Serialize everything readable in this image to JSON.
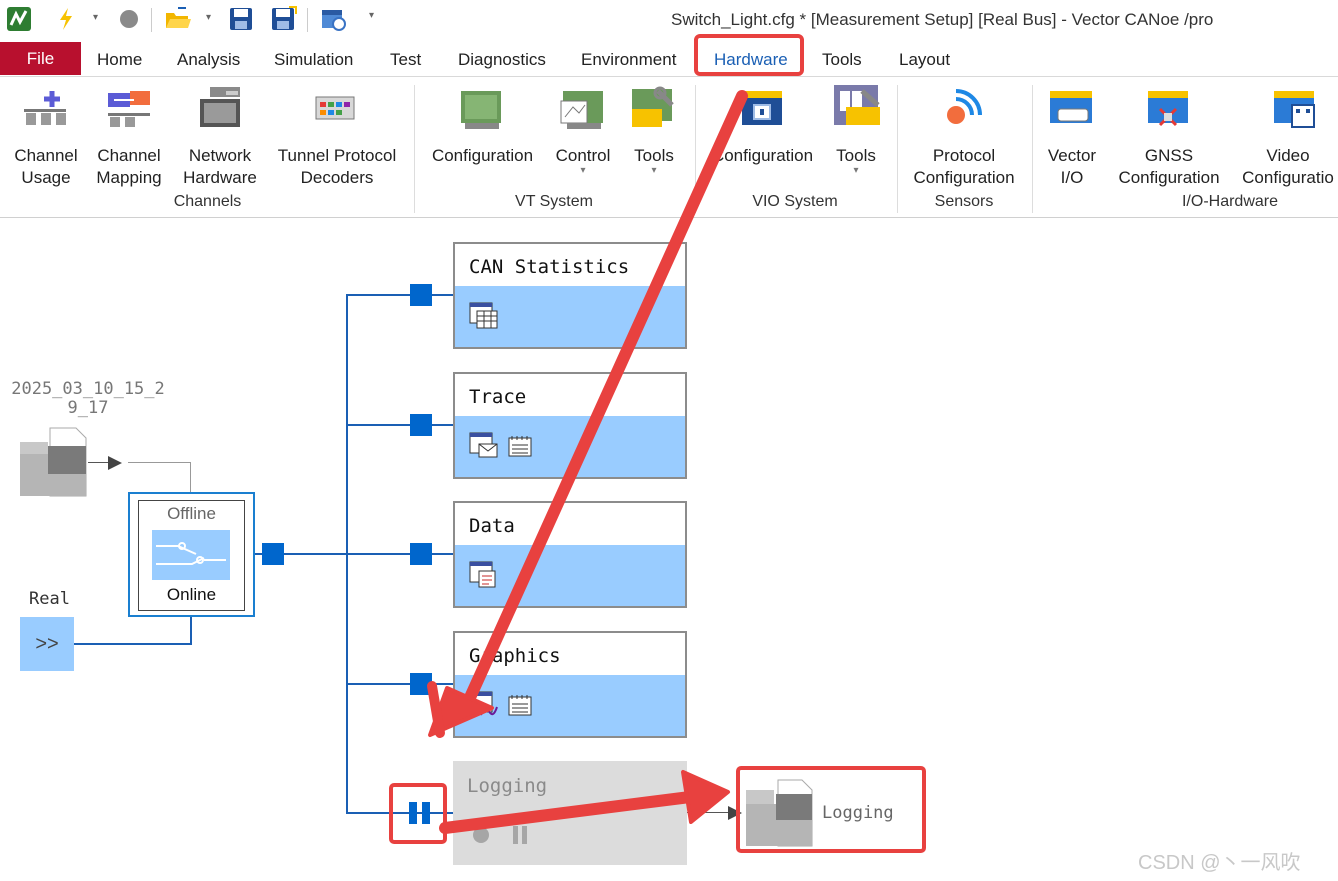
{
  "window": {
    "title": "Switch_Light.cfg * [Measurement Setup] [Real Bus] - Vector CANoe /pro"
  },
  "tabs": [
    "File",
    "Home",
    "Analysis",
    "Simulation",
    "Test",
    "Diagnostics",
    "Environment",
    "Hardware",
    "Tools",
    "Layout"
  ],
  "ribbon": {
    "buttons": [
      {
        "l1": "Channel",
        "l2": "Usage"
      },
      {
        "l1": "Channel",
        "l2": "Mapping"
      },
      {
        "l1": "Network",
        "l2": "Hardware"
      },
      {
        "l1": "Tunnel Protocol",
        "l2": "Decoders"
      },
      {
        "l1": "Configuration",
        "l2": ""
      },
      {
        "l1": "Control",
        "l2": ""
      },
      {
        "l1": "Tools",
        "l2": ""
      },
      {
        "l1": "Configuration",
        "l2": ""
      },
      {
        "l1": "Tools",
        "l2": ""
      },
      {
        "l1": "Protocol",
        "l2": "Configuration"
      },
      {
        "l1": "Vector",
        "l2": "I/O"
      },
      {
        "l1": "GNSS",
        "l2": "Configuration"
      },
      {
        "l1": "Video",
        "l2": "Configuratio"
      }
    ],
    "groups": [
      "Channels",
      "VT System",
      "VIO System",
      "Sensors",
      "I/O-Hardware"
    ]
  },
  "setup": {
    "source_file": {
      "line1": "2025_03_10_15_2",
      "line2": "9_17"
    },
    "real_label": "Real",
    "real_symbol": ">>",
    "switch": {
      "offline": "Offline",
      "online": "Online"
    },
    "blocks": [
      "CAN Statistics",
      "Trace",
      "Data",
      "Graphics",
      "Logging"
    ],
    "logging_file": "Logging"
  },
  "watermark": "CSDN @丶一风吹",
  "colors": {
    "accent": "#1a5fb4",
    "file_tab": "#b8102e",
    "block_body": "#99ccff",
    "node": "#0066cc",
    "highlight": "#e8413f"
  }
}
